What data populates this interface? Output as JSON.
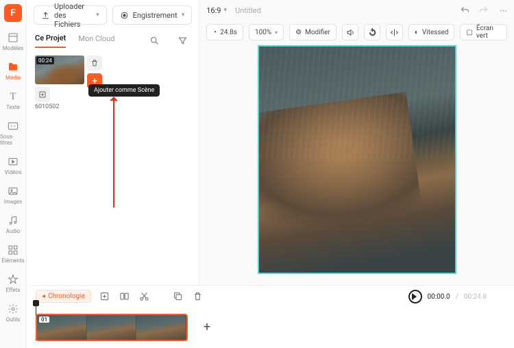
{
  "rail": {
    "items": [
      {
        "label": "Modèles",
        "name": "templates",
        "icon": "layers"
      },
      {
        "label": "Média",
        "name": "media",
        "icon": "folder",
        "active": true
      },
      {
        "label": "Texte",
        "name": "text",
        "icon": "T"
      },
      {
        "label": "Sous-titres",
        "name": "subtitles",
        "icon": "cc"
      },
      {
        "label": "Vidéos",
        "name": "videos",
        "icon": "play"
      },
      {
        "label": "Images",
        "name": "images",
        "icon": "image"
      },
      {
        "label": "Audio",
        "name": "audio",
        "icon": "music"
      },
      {
        "label": "Éléments",
        "name": "elements",
        "icon": "grid"
      },
      {
        "label": "Effets",
        "name": "effects",
        "icon": "star"
      },
      {
        "label": "Outils",
        "name": "tools",
        "icon": "gear"
      }
    ]
  },
  "mid": {
    "upload_btn": "Uploader des Fichiers",
    "record_btn": "Engistrement",
    "tabs": [
      {
        "label": "Ce Projet",
        "active": true
      },
      {
        "label": "Mon Cloud",
        "active": false
      }
    ],
    "clip": {
      "duration": "00:24",
      "filename": "6010502",
      "tooltip": "Ajouter comme Scène"
    }
  },
  "right": {
    "ratio": "16:9",
    "title": "Untitled",
    "tools": {
      "duration": "24.8s",
      "zoom": "100%",
      "modify": "Modifier",
      "speed": "Vitessed",
      "greenscreen": "Écran vert"
    }
  },
  "bottom": {
    "chronologie": "Chronologie",
    "time_current": "00:00.0",
    "time_total": "00:24.8",
    "clip_index": "01"
  },
  "colors": {
    "accent": "#ff5a1f"
  }
}
